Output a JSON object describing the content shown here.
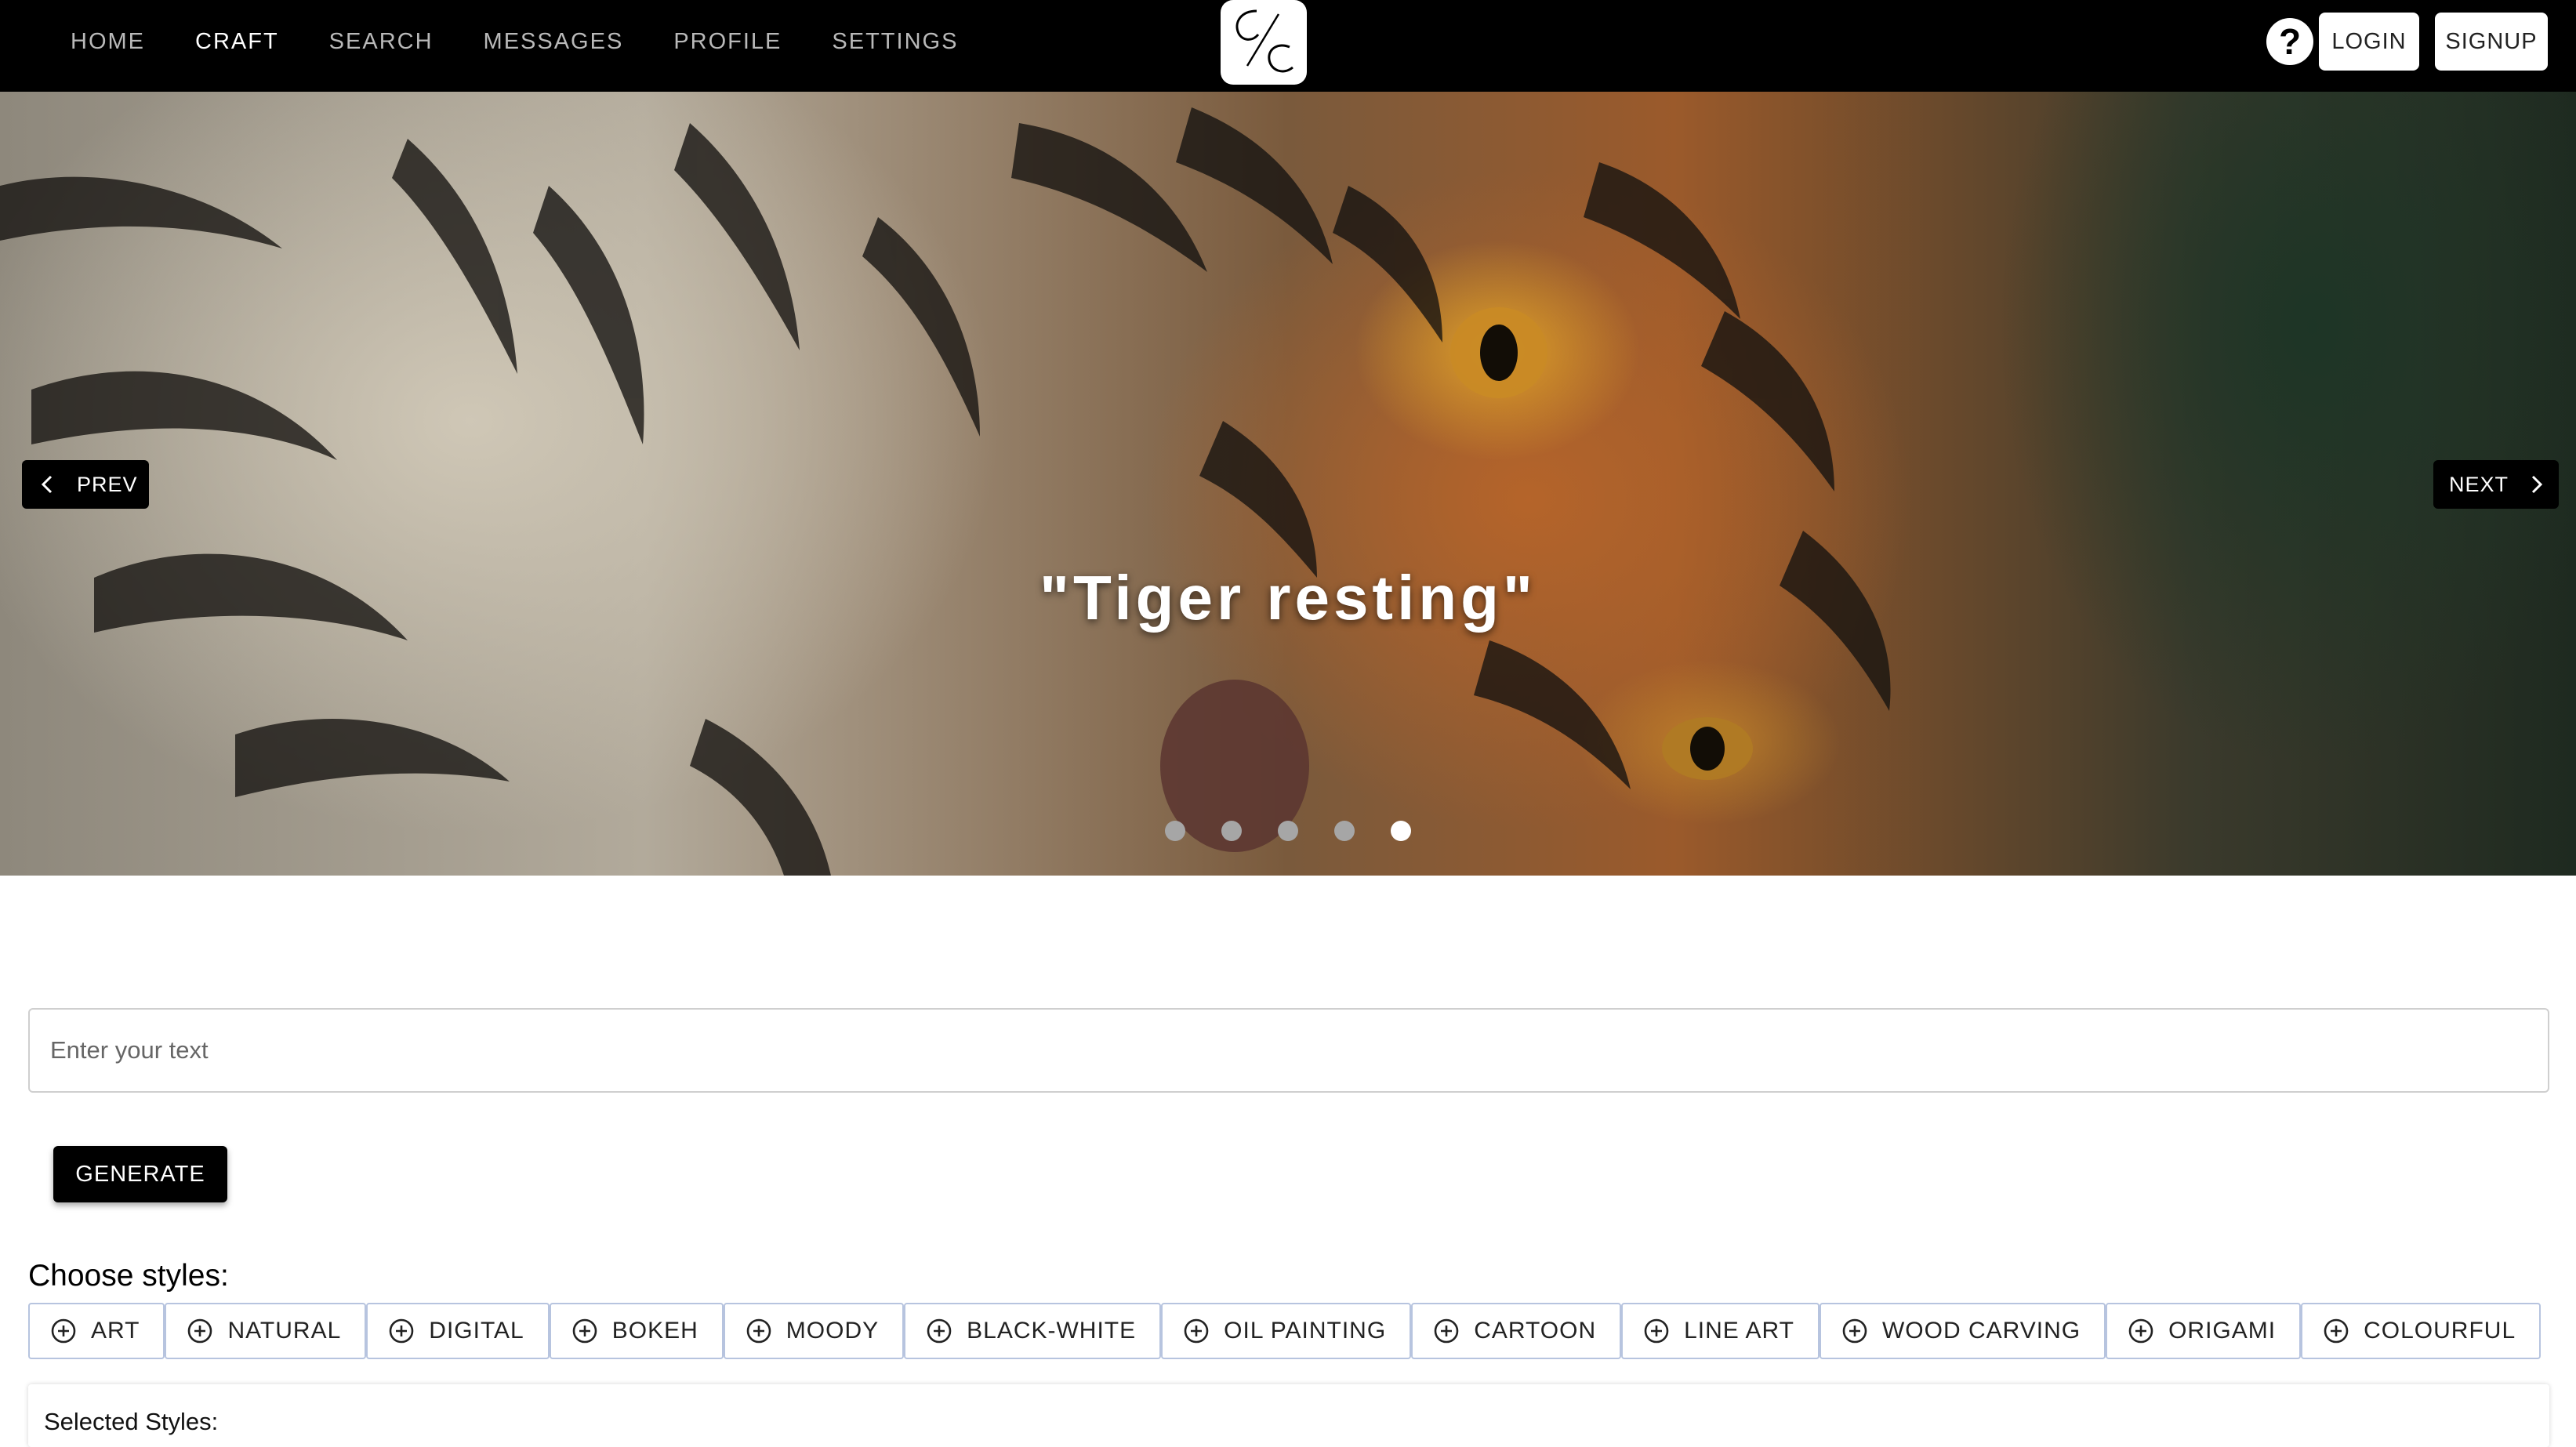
{
  "nav": {
    "links": [
      "HOME",
      "CRAFT",
      "SEARCH",
      "MESSAGES",
      "PROFILE",
      "SETTINGS"
    ],
    "active": "CRAFT",
    "help_icon": "?",
    "login_label": "LOGIN",
    "signup_label": "SIGNUP"
  },
  "carousel": {
    "prev_label": "PREV",
    "next_label": "NEXT",
    "caption": "\"Tiger resting\"",
    "slide_count": 5,
    "active_index": 4
  },
  "prompt": {
    "placeholder": "Enter your text",
    "value": ""
  },
  "generate_label": "GENERATE",
  "styles": {
    "heading": "Choose styles:",
    "options": [
      "ART",
      "NATURAL",
      "DIGITAL",
      "BOKEH",
      "MOODY",
      "BLACK-WHITE",
      "OIL PAINTING",
      "CARTOON",
      "LINE ART",
      "WOOD CARVING",
      "ORIGAMI",
      "COLOURFUL"
    ]
  },
  "selected": {
    "label": "Selected Styles:"
  },
  "colors": {
    "nav_bg": "#000000",
    "chip_border": "#b7c4df",
    "active_dot": "#ffffff",
    "inactive_dot": "#a6a6a6"
  }
}
